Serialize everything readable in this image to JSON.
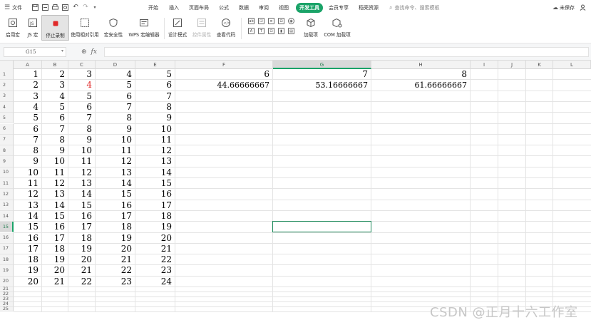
{
  "menubar": {
    "file_label": "文件",
    "tabs": [
      "开始",
      "插入",
      "页面布局",
      "公式",
      "数据",
      "审阅",
      "视图",
      "开发工具",
      "会员专享",
      "稻壳资源"
    ],
    "active_tab": "开发工具",
    "search_placeholder": "查找命令、搜索模板",
    "save_status": "未保存",
    "accent_color": "#1aa368"
  },
  "ribbon": {
    "buttons": [
      "启用宏",
      "JS 宏",
      "停止录制",
      "使用相对引用",
      "宏安全性",
      "WPS 宏编辑器",
      "设计模式",
      "控件属性",
      "查看代码",
      "加载项",
      "COM 加载项"
    ],
    "mini_controls": [
      "ab",
      "☑",
      "≡",
      "⊟",
      "◉",
      "A",
      "T",
      "⊡",
      "▮",
      "▤"
    ]
  },
  "formula_bar": {
    "cell_ref": "G15",
    "fx_label": "fx",
    "zoom_icon": "zoom-icon",
    "formula_value": ""
  },
  "sheet": {
    "columns": [
      "A",
      "B",
      "C",
      "D",
      "E",
      "F",
      "G",
      "H",
      "I",
      "J",
      "K",
      "L"
    ],
    "selected_column": "G",
    "selected_row": "15",
    "row_numbers": [
      "1",
      "2",
      "3",
      "4",
      "5",
      "6",
      "7",
      "8",
      "9",
      "10",
      "11",
      "12",
      "13",
      "14",
      "15",
      "16",
      "17",
      "18",
      "19",
      "20",
      "21",
      "22",
      "23",
      "24",
      "25"
    ],
    "data_rows": [
      [
        "1",
        "2",
        "3",
        "4",
        "5"
      ],
      [
        "2",
        "3",
        "4",
        "5",
        "6"
      ],
      [
        "3",
        "4",
        "5",
        "6",
        "7"
      ],
      [
        "4",
        "5",
        "6",
        "7",
        "8"
      ],
      [
        "5",
        "6",
        "7",
        "8",
        "9"
      ],
      [
        "6",
        "7",
        "8",
        "9",
        "10"
      ],
      [
        "7",
        "8",
        "9",
        "10",
        "11"
      ],
      [
        "8",
        "9",
        "10",
        "11",
        "12"
      ],
      [
        "9",
        "10",
        "11",
        "12",
        "13"
      ],
      [
        "10",
        "11",
        "12",
        "13",
        "14"
      ],
      [
        "11",
        "12",
        "13",
        "14",
        "15"
      ],
      [
        "12",
        "13",
        "14",
        "15",
        "16"
      ],
      [
        "13",
        "14",
        "15",
        "16",
        "17"
      ],
      [
        "14",
        "15",
        "16",
        "17",
        "18"
      ],
      [
        "15",
        "16",
        "17",
        "18",
        "19"
      ],
      [
        "16",
        "17",
        "18",
        "19",
        "20"
      ],
      [
        "17",
        "18",
        "19",
        "20",
        "21"
      ],
      [
        "18",
        "19",
        "20",
        "21",
        "22"
      ],
      [
        "19",
        "20",
        "21",
        "22",
        "23"
      ],
      [
        "20",
        "21",
        "22",
        "23",
        "24"
      ]
    ],
    "highlight_cell": {
      "row": 2,
      "col": "C",
      "color": "#e02a2a"
    },
    "f_col": [
      "6",
      "44.66666667"
    ],
    "g_col": [
      "7",
      "53.16666667"
    ],
    "h_col": [
      "8",
      "61.66666667"
    ],
    "selection_color": "#1f8a5b"
  },
  "watermark": "CSDN @正月十六工作室"
}
